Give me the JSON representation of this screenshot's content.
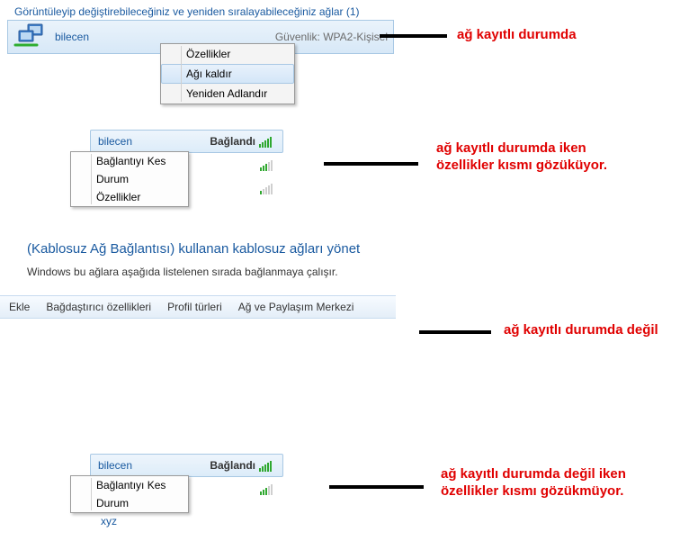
{
  "section1": {
    "header": "Görüntüleyip değiştirebileceğiniz ve yeniden sıralayabileceğiniz ağlar (1)",
    "network_name": "bilecen",
    "security_label": "Güvenlik:",
    "security_value": "WPA2-Kişisel",
    "ctx": {
      "properties": "Özellikler",
      "remove": "Ağı kaldır",
      "rename": "Yeniden Adlandır"
    }
  },
  "annotation1": "ağ kayıtlı durumda",
  "flyout1": {
    "name": "bilecen",
    "status": "Bağlandı",
    "ctx": {
      "disconnect": "Bağlantıyı Kes",
      "status": "Durum",
      "properties": "Özellikler"
    }
  },
  "annotation2_line1": "ağ kayıtlı durumda iken",
  "annotation2_line2": "özellikler kısmı gözüküyor.",
  "manager": {
    "title": "(Kablosuz Ağ Bağlantısı) kullanan kablosuz ağları yönet",
    "sub": "Windows bu ağlara aşağıda listelenen sırada bağlanmaya çalışır.",
    "toolbar": {
      "add": "Ekle",
      "adapter": "Bağdaştırıcı özellikleri",
      "profiles": "Profil türleri",
      "center": "Ağ ve Paylaşım Merkezi"
    }
  },
  "annotation3": "ağ kayıtlı durumda değil",
  "flyout2": {
    "name": "bilecen",
    "status": "Bağlandı",
    "ctx": {
      "disconnect": "Bağlantıyı Kes",
      "status": "Durum"
    },
    "partial_other": "xyz"
  },
  "annotation4_line1": "ağ kayıtlı durumda değil iken",
  "annotation4_line2": "özellikler kısmı gözükmüyor."
}
